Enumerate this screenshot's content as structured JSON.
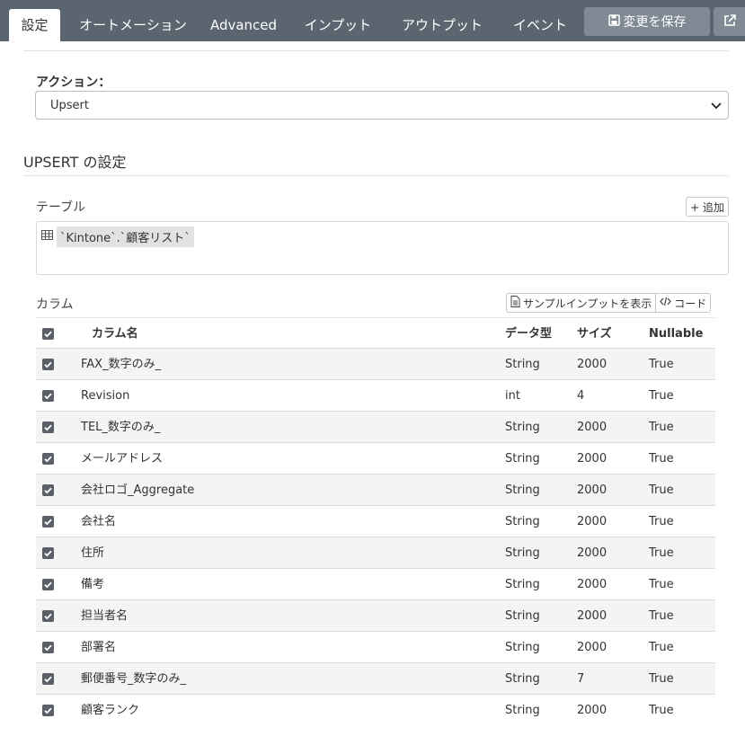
{
  "tabs": [
    {
      "label": "設定",
      "active": true
    },
    {
      "label": "オートメーション"
    },
    {
      "label": "Advanced"
    },
    {
      "label": "インプット"
    },
    {
      "label": "アウトプット"
    },
    {
      "label": "イベント"
    }
  ],
  "toolbar": {
    "save_label": "変更を保存",
    "save_icon": "floppy-icon",
    "external_icon": "external-link-icon"
  },
  "action": {
    "label": "アクション：",
    "selected": "Upsert"
  },
  "section": {
    "title": "UPSERT の設定"
  },
  "table": {
    "label": "テーブル",
    "add_label": "+ 追加",
    "value": "`Kintone`.`顧客リスト`"
  },
  "columns": {
    "label": "カラム",
    "sample_button": "サンプルインプットを表示",
    "code_button": "コード",
    "headers": {
      "name": "カラム名",
      "type": "データ型",
      "size": "サイズ",
      "nullable": "Nullable"
    },
    "rows": [
      {
        "name": "FAX_数字のみ_",
        "type": "String",
        "size": "2000",
        "nullable": "True"
      },
      {
        "name": "Revision",
        "type": "int",
        "size": "4",
        "nullable": "True"
      },
      {
        "name": "TEL_数字のみ_",
        "type": "String",
        "size": "2000",
        "nullable": "True"
      },
      {
        "name": "メールアドレス",
        "type": "String",
        "size": "2000",
        "nullable": "True"
      },
      {
        "name": "会社ロゴ_Aggregate",
        "type": "String",
        "size": "2000",
        "nullable": "True"
      },
      {
        "name": "会社名",
        "type": "String",
        "size": "2000",
        "nullable": "True"
      },
      {
        "name": "住所",
        "type": "String",
        "size": "2000",
        "nullable": "True"
      },
      {
        "name": "備考",
        "type": "String",
        "size": "2000",
        "nullable": "True"
      },
      {
        "name": "担当者名",
        "type": "String",
        "size": "2000",
        "nullable": "True"
      },
      {
        "name": "部署名",
        "type": "String",
        "size": "2000",
        "nullable": "True"
      },
      {
        "name": "郵便番号_数字のみ_",
        "type": "String",
        "size": "7",
        "nullable": "True"
      },
      {
        "name": "顧客ランク",
        "type": "String",
        "size": "2000",
        "nullable": "True"
      }
    ]
  }
}
